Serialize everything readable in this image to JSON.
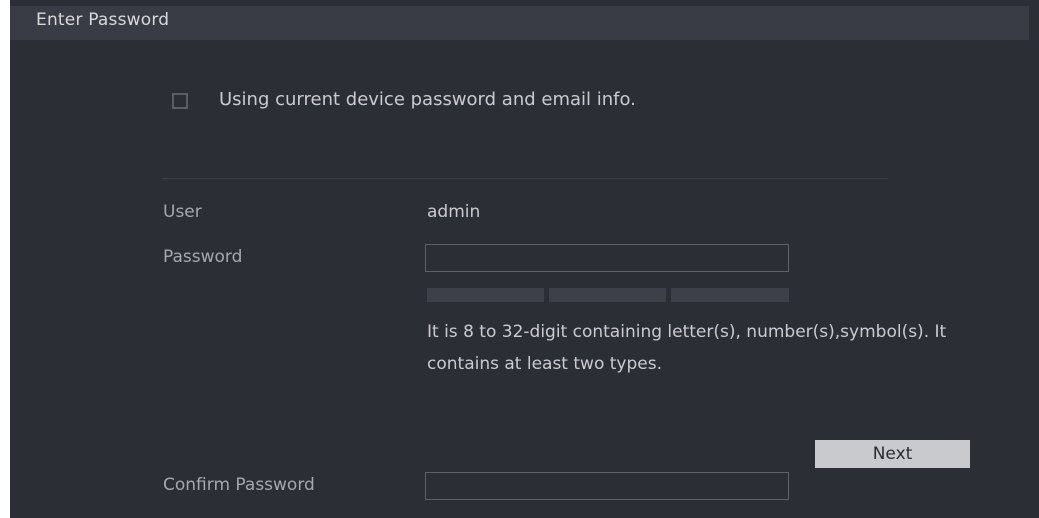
{
  "window": {
    "title": "Enter Password"
  },
  "options": {
    "use_current_label": "Using current device password and email info.",
    "use_current_checked": false
  },
  "form": {
    "user_label": "User",
    "user_value": "admin",
    "password_label": "Password",
    "password_value": "",
    "password_strength_segments": 3,
    "password_hint": "It is 8 to 32-digit containing letter(s), number(s),symbol(s). It contains at least two types.",
    "confirm_label": "Confirm Password",
    "confirm_value": ""
  },
  "actions": {
    "next_label": "Next"
  },
  "colors": {
    "background": "#2c2e36",
    "titlebar": "#393c45",
    "button": "#c9cacd",
    "accent_mark": "#c8202a"
  }
}
